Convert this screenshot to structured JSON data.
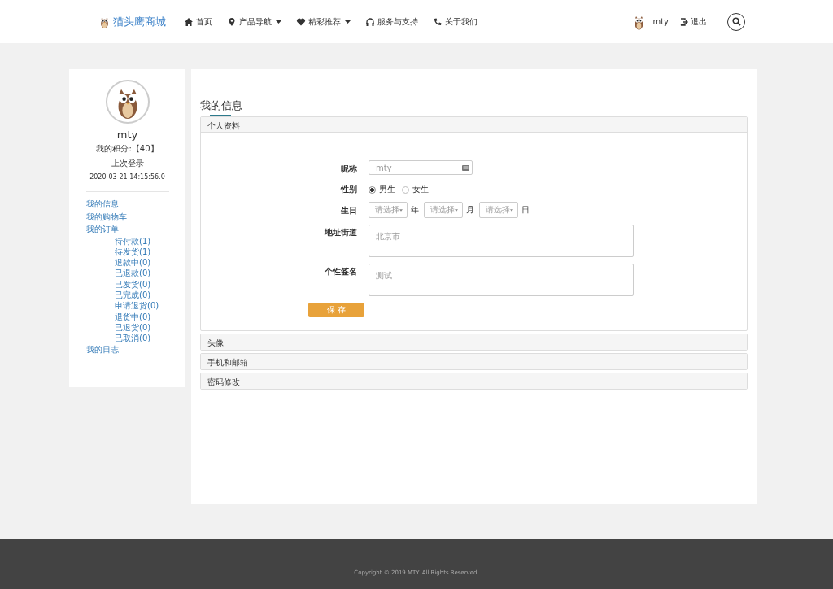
{
  "header": {
    "logo": "猫头鹰商城",
    "nav": [
      {
        "label": "首页",
        "dropdown": false
      },
      {
        "label": "产品导航",
        "dropdown": true
      },
      {
        "label": "精彩推荐",
        "dropdown": true
      },
      {
        "label": "服务与支持",
        "dropdown": false
      },
      {
        "label": "关于我们",
        "dropdown": false
      }
    ],
    "user": "mty",
    "logout": "退出"
  },
  "sidebar": {
    "username": "mty",
    "points": "我的积分:【40】",
    "last_login_label": "上次登录",
    "last_login_time": "2020-03-21 14:15:56.0",
    "menu": [
      {
        "label": "我的信息"
      },
      {
        "label": "我的购物车"
      },
      {
        "label": "我的订单",
        "children": [
          {
            "label": "待付款(1)"
          },
          {
            "label": "待发货(1)"
          },
          {
            "label": "退款中(0)"
          },
          {
            "label": "已退款(0)"
          },
          {
            "label": "已发货(0)"
          },
          {
            "label": "已完成(0)"
          },
          {
            "label": "申请退货(0)"
          },
          {
            "label": "退货中(0)"
          },
          {
            "label": "已退货(0)"
          },
          {
            "label": "已取消(0)"
          }
        ]
      },
      {
        "label": "我的日志"
      }
    ]
  },
  "main": {
    "title": "我的信息",
    "panels": [
      {
        "title": "个人资料",
        "expanded": true
      },
      {
        "title": "头像",
        "expanded": false
      },
      {
        "title": "手机和邮箱",
        "expanded": false
      },
      {
        "title": "密码修改",
        "expanded": false
      }
    ],
    "form": {
      "fields": [
        {
          "kind": "text",
          "label": "昵称",
          "value": "mty"
        },
        {
          "kind": "radio",
          "label": "性别",
          "options": [
            {
              "label": "男生",
              "selected": true
            },
            {
              "label": "女生",
              "selected": false
            }
          ]
        },
        {
          "kind": "date",
          "label": "生日",
          "parts": [
            {
              "value": "请选择",
              "unit": "年"
            },
            {
              "value": "请选择",
              "unit": "月"
            },
            {
              "value": "请选择",
              "unit": "日"
            }
          ]
        },
        {
          "kind": "textarea",
          "label": "地址街道",
          "value": "北京市"
        },
        {
          "kind": "textarea",
          "label": "个性签名",
          "value": "测试"
        }
      ],
      "submit": "保 存"
    }
  },
  "footer": {
    "copyright": "Copyright © 2019 MTY. All Rights Reserved."
  }
}
